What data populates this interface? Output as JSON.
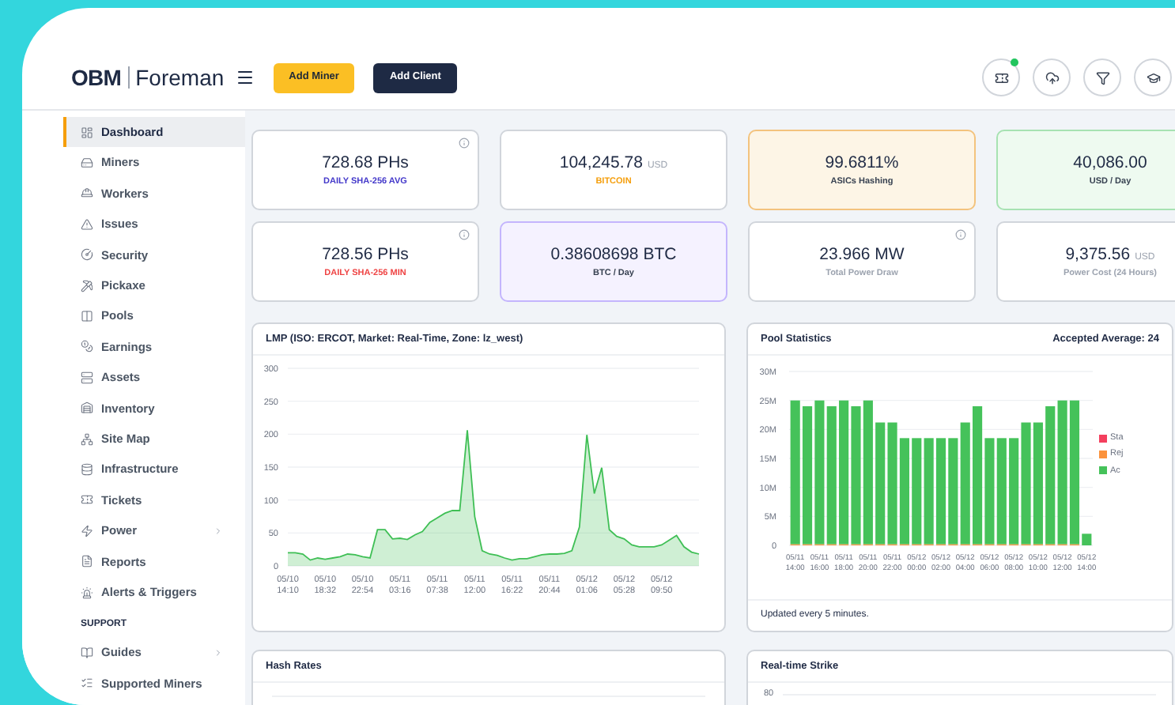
{
  "header": {
    "logo_brand": "OBM",
    "logo_product": "Foreman",
    "buttons": [
      {
        "label": "Add Miner",
        "kind": "primary"
      },
      {
        "label": "Add Client",
        "kind": "dark"
      }
    ],
    "icons": [
      {
        "notification": true
      },
      {
        "notification": false
      },
      {
        "notification": false
      },
      {
        "notification": false
      }
    ]
  },
  "sidebar": {
    "items": [
      {
        "label": "Dashboard",
        "selected": true,
        "has_submenu": false
      },
      {
        "label": "Miners",
        "selected": false,
        "has_submenu": false
      },
      {
        "label": "Workers",
        "selected": false,
        "has_submenu": false
      },
      {
        "label": "Issues",
        "selected": false,
        "has_submenu": false
      },
      {
        "label": "Security",
        "selected": false,
        "has_submenu": false
      },
      {
        "label": "Pickaxe",
        "selected": false,
        "has_submenu": false
      },
      {
        "label": "Pools",
        "selected": false,
        "has_submenu": false
      },
      {
        "label": "Earnings",
        "selected": false,
        "has_submenu": false
      },
      {
        "label": "Assets",
        "selected": false,
        "has_submenu": false
      },
      {
        "label": "Inventory",
        "selected": false,
        "has_submenu": false
      },
      {
        "label": "Site Map",
        "selected": false,
        "has_submenu": false
      },
      {
        "label": "Infrastructure",
        "selected": false,
        "has_submenu": false
      },
      {
        "label": "Tickets",
        "selected": false,
        "has_submenu": false
      },
      {
        "label": "Power",
        "selected": false,
        "has_submenu": true
      },
      {
        "label": "Reports",
        "selected": false,
        "has_submenu": false
      },
      {
        "label": "Alerts & Triggers",
        "selected": false,
        "has_submenu": false
      }
    ],
    "section": "SUPPORT",
    "support_items": [
      {
        "label": "Guides",
        "selected": false,
        "has_submenu": true
      },
      {
        "label": "Supported Miners",
        "selected": false,
        "has_submenu": false
      }
    ]
  },
  "cards": [
    {
      "value": "728.68 PHs",
      "label": "DAILY SHA-256 AVG",
      "color": "#4338ca",
      "kind": "plain",
      "info": true
    },
    {
      "value": "104,245.78",
      "unit": "USD",
      "label": "BITCOIN",
      "color": "#f59e0b",
      "kind": "plain",
      "info": false
    },
    {
      "value": "99.6811%",
      "label": "ASICs Hashing",
      "color": "#374151",
      "kind": "warning",
      "info": false
    },
    {
      "value": "40,086.00",
      "label": "USD / Day",
      "color": "#374151",
      "kind": "success",
      "info": false
    },
    {
      "value": "728.56 PHs",
      "label": "DAILY SHA-256 MIN",
      "color": "#ef4444",
      "kind": "plain",
      "info": true
    },
    {
      "value": "0.38608698 BTC",
      "label": "BTC / Day",
      "color": "#374151",
      "kind": "highlight",
      "info": false
    },
    {
      "value": "23.966 MW",
      "label": "Total Power Draw",
      "color": "#9ca3af",
      "kind": "plain",
      "info": true
    },
    {
      "value": "9,375.56",
      "unit": "USD",
      "label": "Power Cost (24 Hours)",
      "color": "#9ca3af",
      "kind": "plain",
      "info": false
    }
  ],
  "lmp_panel": {
    "title": "LMP (ISO: ERCOT, Market: Real-Time, Zone: lz_west)",
    "chart_data": {
      "type": "area",
      "grid": true,
      "categories": [
        "05/10 14:10",
        null,
        null,
        null,
        null,
        "05/10 18:32",
        null,
        null,
        null,
        null,
        "05/10 22:54",
        null,
        null,
        null,
        null,
        "05/11 03:16",
        null,
        null,
        null,
        null,
        "05/11 07:38",
        null,
        null,
        null,
        null,
        "05/11 12:00",
        null,
        null,
        null,
        null,
        "05/11 16:22",
        null,
        null,
        null,
        null,
        "05/11 20:44",
        null,
        null,
        null,
        null,
        "05/12 01:06",
        null,
        null,
        null,
        null,
        "05/12 05:28",
        null,
        null,
        null,
        null,
        "05/12 09:50",
        null,
        null,
        null,
        null,
        null
      ],
      "series": [
        {
          "color": "#3fbf55",
          "values": [
            20,
            20,
            18,
            9,
            12,
            10,
            12,
            14,
            18,
            17,
            14,
            12,
            55,
            55,
            41,
            42,
            40,
            47,
            52,
            66,
            73,
            80,
            84,
            84,
            206,
            75,
            23,
            18,
            16,
            12,
            9,
            11,
            11,
            14,
            17,
            18,
            18,
            19,
            23,
            59,
            199,
            110,
            149,
            55,
            45,
            41,
            32,
            29,
            29,
            29,
            32,
            39,
            46,
            29,
            21,
            18
          ]
        }
      ],
      "ylim": [
        0,
        300
      ],
      "yticks": [
        0,
        50,
        100,
        150,
        200,
        250,
        300
      ]
    }
  },
  "pool_panel": {
    "title": "Pool Statistics",
    "summary": "Accepted Average: 24",
    "footer": "Updated every 5 minutes.",
    "chart_data": {
      "type": "bar",
      "stacked": true,
      "grid": true,
      "categories": [
        "05/11 14:00",
        null,
        "05/11 16:00",
        null,
        "05/11 18:00",
        null,
        "05/11 20:00",
        null,
        "05/11 22:00",
        null,
        "05/12 00:00",
        null,
        "05/12 02:00",
        null,
        "05/12 04:00",
        null,
        "05/12 06:00",
        null,
        "05/12 08:00",
        null,
        "05/12 10:00",
        null,
        "05/12 12:00",
        null,
        "05/12 14:00"
      ],
      "series": [
        {
          "name": "Sta",
          "color": "#f43f5e",
          "values": [
            0,
            0,
            0,
            0,
            0,
            0,
            0,
            0,
            0,
            0,
            0,
            0,
            0,
            0,
            0,
            0,
            0,
            0,
            0,
            0,
            0,
            0,
            0,
            0,
            0
          ]
        },
        {
          "name": "Rej",
          "color": "#fb923c",
          "values": [
            0.2,
            0.2,
            0.2,
            0.2,
            0.2,
            0.2,
            0.2,
            0.2,
            0.2,
            0.2,
            0.2,
            0.2,
            0.2,
            0.2,
            0.2,
            0.2,
            0.2,
            0.2,
            0.2,
            0.2,
            0.2,
            0.2,
            0.2,
            0.2,
            0
          ]
        },
        {
          "name": "Ac",
          "color": "#45c25a",
          "values": [
            24.8,
            23.8,
            24.8,
            23.8,
            24.8,
            23.8,
            24.8,
            21,
            21,
            18.3,
            18.3,
            18.3,
            18.3,
            18.3,
            21,
            23.8,
            18.3,
            18.3,
            18.3,
            21,
            21,
            23.8,
            24.8,
            24.8,
            2
          ]
        }
      ],
      "ylim": [
        0,
        30
      ],
      "yticks": [
        {
          "value": 0,
          "label": "0"
        },
        {
          "value": 5,
          "label": "5M"
        },
        {
          "value": 10,
          "label": "10M"
        },
        {
          "value": 15,
          "label": "15M"
        },
        {
          "value": 20,
          "label": "20M"
        },
        {
          "value": 25,
          "label": "25M"
        },
        {
          "value": 30,
          "label": "30M"
        }
      ]
    }
  },
  "hash_panel": {
    "title": "Hash Rates"
  },
  "strike_panel": {
    "title": "Real-time Strike",
    "y_tick": "80"
  }
}
